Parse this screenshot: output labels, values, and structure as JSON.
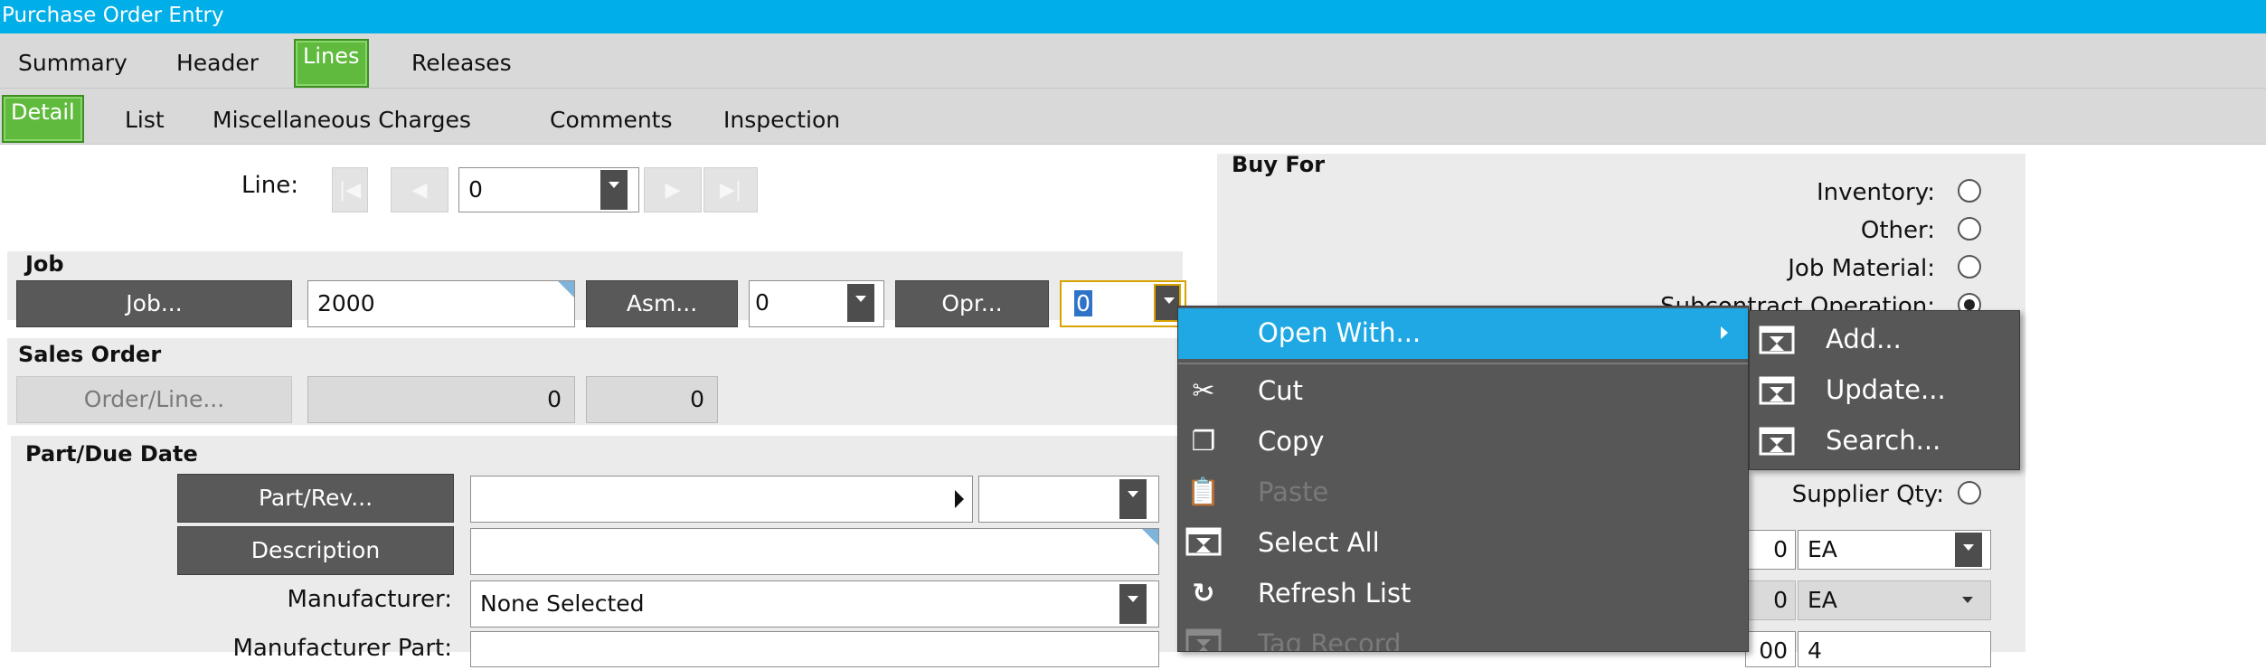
{
  "window": {
    "title": "Purchase Order Entry"
  },
  "tabs_main": [
    {
      "label": "Summary"
    },
    {
      "label": "Header"
    },
    {
      "label": "Lines",
      "active": true
    },
    {
      "label": "Releases"
    }
  ],
  "tabs_sub": [
    {
      "label": "Detail",
      "active": true
    },
    {
      "label": "List"
    },
    {
      "label": "Miscellaneous Charges"
    },
    {
      "label": "Comments"
    },
    {
      "label": "Inspection"
    }
  ],
  "line": {
    "label": "Line:",
    "value": "0"
  },
  "job": {
    "group_label": "Job",
    "job_button": "Job...",
    "job_value": "2000",
    "asm_button": "Asm...",
    "asm_value": "0",
    "opr_button": "Opr...",
    "opr_value": "0"
  },
  "sales_order": {
    "group_label": "Sales Order",
    "orderline_button": "Order/Line...",
    "order_value": "0",
    "line_value": "0"
  },
  "part": {
    "group_label": "Part/Due Date",
    "partrev_button": "Part/Rev...",
    "part_value": "",
    "rev_value": "",
    "description_button": "Description",
    "description_value": "",
    "manufacturer_label": "Manufacturer:",
    "manufacturer_value": "None Selected",
    "manufacturer_part_label": "Manufacturer Part:",
    "manufacturer_part_value": ""
  },
  "buy_for": {
    "group_label": "Buy For",
    "options": [
      {
        "label": "Inventory:",
        "checked": false
      },
      {
        "label": "Other:",
        "checked": false
      },
      {
        "label": "Job Material:",
        "checked": false
      },
      {
        "label": "Subcontract Operation:",
        "checked": true
      }
    ]
  },
  "qty": {
    "supplier_qty_label": "Supplier Qty:",
    "row1_value": "0",
    "row1_uom": "EA",
    "row2_value": "0",
    "row2_uom": "EA",
    "row3_value": "00",
    "row3_uom": "4"
  },
  "context_menu": {
    "items": [
      {
        "label": "Open With...",
        "icon": "none",
        "highlighted": true,
        "submenu": true,
        "enabled": true
      },
      {
        "label": "Cut",
        "icon": "scissors-icon",
        "enabled": true
      },
      {
        "label": "Copy",
        "icon": "copy-icon",
        "enabled": true
      },
      {
        "label": "Paste",
        "icon": "paste-icon",
        "enabled": false
      },
      {
        "label": "Select All",
        "icon": "form-icon",
        "enabled": true
      },
      {
        "label": "Refresh List",
        "icon": "refresh-icon",
        "enabled": true
      },
      {
        "label": "Tag Record",
        "icon": "form-icon",
        "enabled": false
      }
    ]
  },
  "submenu": {
    "items": [
      {
        "label": "Add...",
        "icon": "form-icon"
      },
      {
        "label": "Update...",
        "icon": "form-icon"
      },
      {
        "label": "Search...",
        "icon": "form-icon"
      }
    ]
  },
  "colors": {
    "title_bar": "#00aee8",
    "active_tab": "#5fba3e",
    "menu_bg": "#575757",
    "menu_highlight": "#1fa8e3"
  }
}
